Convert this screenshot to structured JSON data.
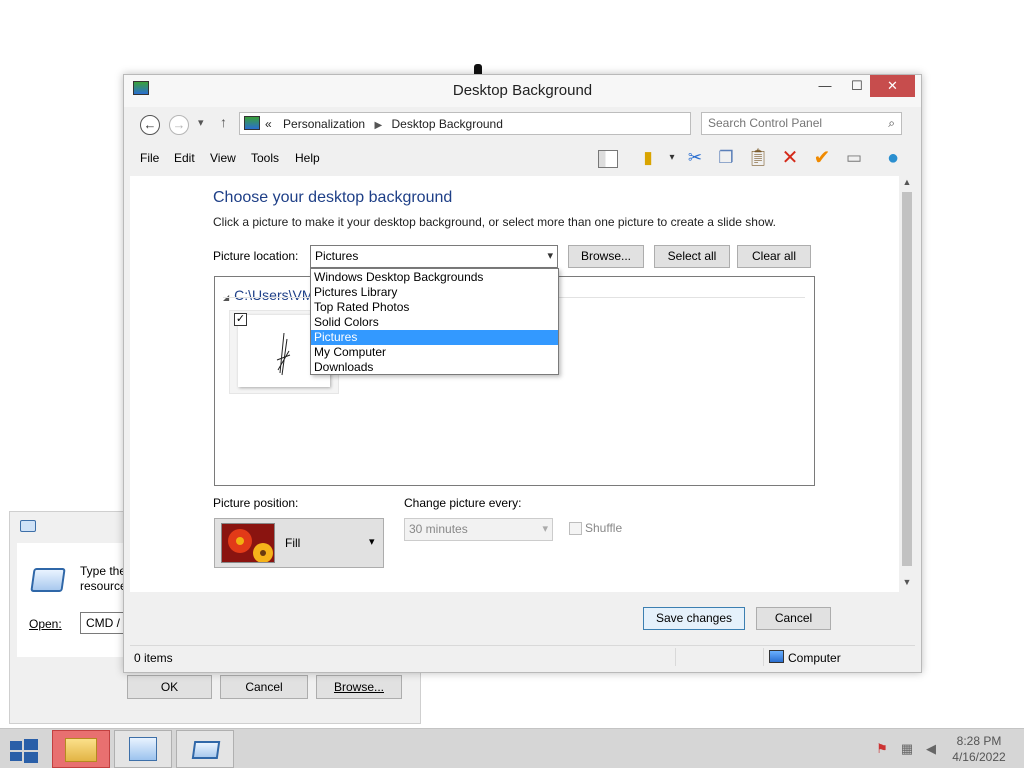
{
  "window": {
    "title": "Desktop Background",
    "controls": {
      "minimize": "—",
      "maximize": "☐",
      "close": "✕"
    }
  },
  "address": {
    "prefix": "«",
    "crumbs": [
      "Personalization",
      "Desktop Background"
    ],
    "search_placeholder": "Search Control Panel"
  },
  "menu": [
    "File",
    "Edit",
    "View",
    "Tools",
    "Help"
  ],
  "toolbar_icons": [
    "layout-icon",
    "properties-icon",
    "cut-icon",
    "copy-icon",
    "paste-icon",
    "delete-icon",
    "check-icon",
    "rename-icon",
    "world-icon"
  ],
  "main": {
    "heading": "Choose your desktop background",
    "subtext": "Click a picture to make it your desktop background, or select more than one picture to create a slide show.",
    "picture_location_label": "Picture location:",
    "picture_location_value": "Pictures",
    "buttons": {
      "browse": "Browse...",
      "select_all": "Select all",
      "clear_all": "Clear all"
    },
    "dropdown_options": [
      "Windows Desktop Backgrounds",
      "Pictures Library",
      "Top Rated Photos",
      "Solid Colors",
      "Pictures",
      "My Computer",
      "Downloads"
    ],
    "dropdown_selected_index": 4,
    "group_header": "C:\\Users\\VM",
    "picture_position_label": "Picture position:",
    "picture_position_value": "Fill",
    "change_picture_label": "Change picture every:",
    "change_picture_value": "30 minutes",
    "shuffle_label": "Shuffle",
    "save_button": "Save changes",
    "cancel_button": "Cancel"
  },
  "status": {
    "items": "0 items",
    "location": "Computer"
  },
  "run_dialog": {
    "text": "Type the\nresource",
    "open_label": "Open:",
    "open_value": "CMD /",
    "ok": "OK",
    "cancel": "Cancel",
    "browse": "Browse..."
  },
  "taskbar": {
    "time": "8:28 PM",
    "date": "4/16/2022"
  },
  "colors": {
    "accent": "#1e3f87",
    "selection": "#3399ff",
    "close": "#c74d4d"
  }
}
